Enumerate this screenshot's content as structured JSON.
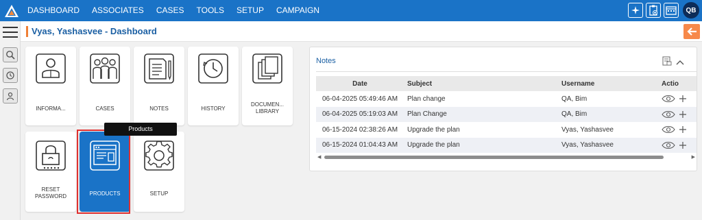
{
  "nav": {
    "items": [
      "DASHBOARD",
      "ASSOCIATES",
      "CASES",
      "TOOLS",
      "SETUP",
      "CAMPAIGN"
    ],
    "active": "ASSOCIATES",
    "avatar_initials": "QB",
    "right_icons": [
      "sparkle-icon",
      "clipboard-add-icon",
      "calendar-icon"
    ]
  },
  "header": {
    "title": "Vyas, Yashasvee - Dashboard"
  },
  "tiles": {
    "information": "INFORMA...",
    "cases": "CASES",
    "notes": "NOTES",
    "history": "HISTORY",
    "document_library_1": "DOCUMEN...",
    "document_library_2": "LIBRARY",
    "reset_password_1": "RESET",
    "reset_password_2": "PASSWORD",
    "products": "PRODUCTS",
    "setup": "SETUP"
  },
  "tooltip": "Products",
  "notes": {
    "title": "Notes",
    "columns": {
      "date": "Date",
      "subject": "Subject",
      "username": "Username",
      "action": "Actio"
    },
    "rows": [
      {
        "date": "06-04-2025 05:49:46 AM",
        "subject": "Plan change",
        "username": "QA, Bim"
      },
      {
        "date": "06-04-2025 05:19:03 AM",
        "subject": "Plan Change",
        "username": "QA, Bim"
      },
      {
        "date": "06-15-2024 02:38:26 AM",
        "subject": "Upgrade the plan",
        "username": "Vyas, Yashasvee"
      },
      {
        "date": "06-15-2024 01:04:43 AM",
        "subject": "Upgrade the plan",
        "username": "Vyas, Yashasvee"
      }
    ]
  },
  "colors": {
    "nav_bg": "#1a73c7",
    "title_blue": "#1a5fa3",
    "accent_orange": "#ef7f35",
    "selection_red": "#e03030"
  }
}
